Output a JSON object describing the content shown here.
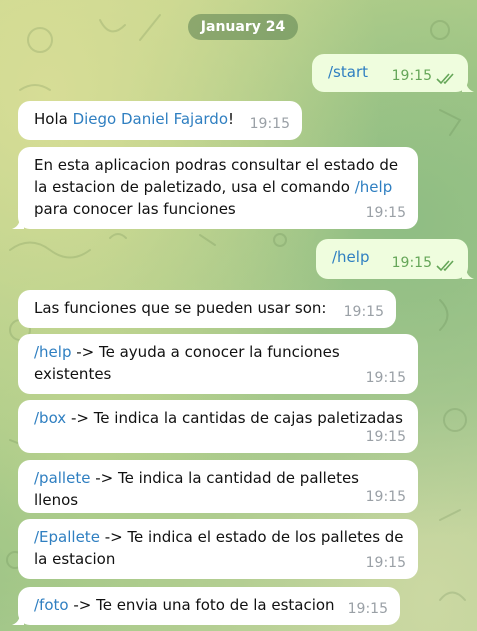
{
  "date_separator": "January 24",
  "messages": [
    {
      "direction": "out",
      "command": "/start",
      "time": "19:15"
    },
    {
      "direction": "in",
      "text_before": "Hola ",
      "name": "Diego Daniel Fajardo",
      "text_after": "!",
      "time": "19:15"
    },
    {
      "direction": "in",
      "line1": "En esta aplicacion podras consultar el estado de",
      "line2": "la estacion de paletizado, usa el comando ",
      "command": "/help",
      "line3": "para conocer las funciones",
      "time": "19:15"
    },
    {
      "direction": "out",
      "command": "/help",
      "time": "19:15"
    },
    {
      "direction": "in",
      "text": "Las funciones que se pueden usar son:",
      "time": "19:15"
    },
    {
      "direction": "in",
      "command": "/help",
      "line1": " -> Te ayuda a conocer la funciones",
      "line2": "existentes",
      "time": "19:15"
    },
    {
      "direction": "in",
      "command": "/box",
      "line1": " -> Te indica la cantidas de cajas paletizadas",
      "time": "19:15"
    },
    {
      "direction": "in",
      "command": "/pallete",
      "line1": " -> Te indica la cantidad de palletes llenos",
      "time": "19:15"
    },
    {
      "direction": "in",
      "command": "/Epallete",
      "line1": " -> Te indica el estado de los palletes de",
      "line2": "la estacion",
      "time": "19:15"
    },
    {
      "direction": "in",
      "command": "/foto",
      "line1": " -> Te envia una foto de la estacion",
      "time": "19:15"
    }
  ],
  "colors": {
    "link": "#2f7fc1",
    "outgoing_bubble": "#effdde",
    "incoming_bubble": "#ffffff",
    "read_ticks": "#65a658"
  },
  "icons": [
    "double-check-icon"
  ]
}
